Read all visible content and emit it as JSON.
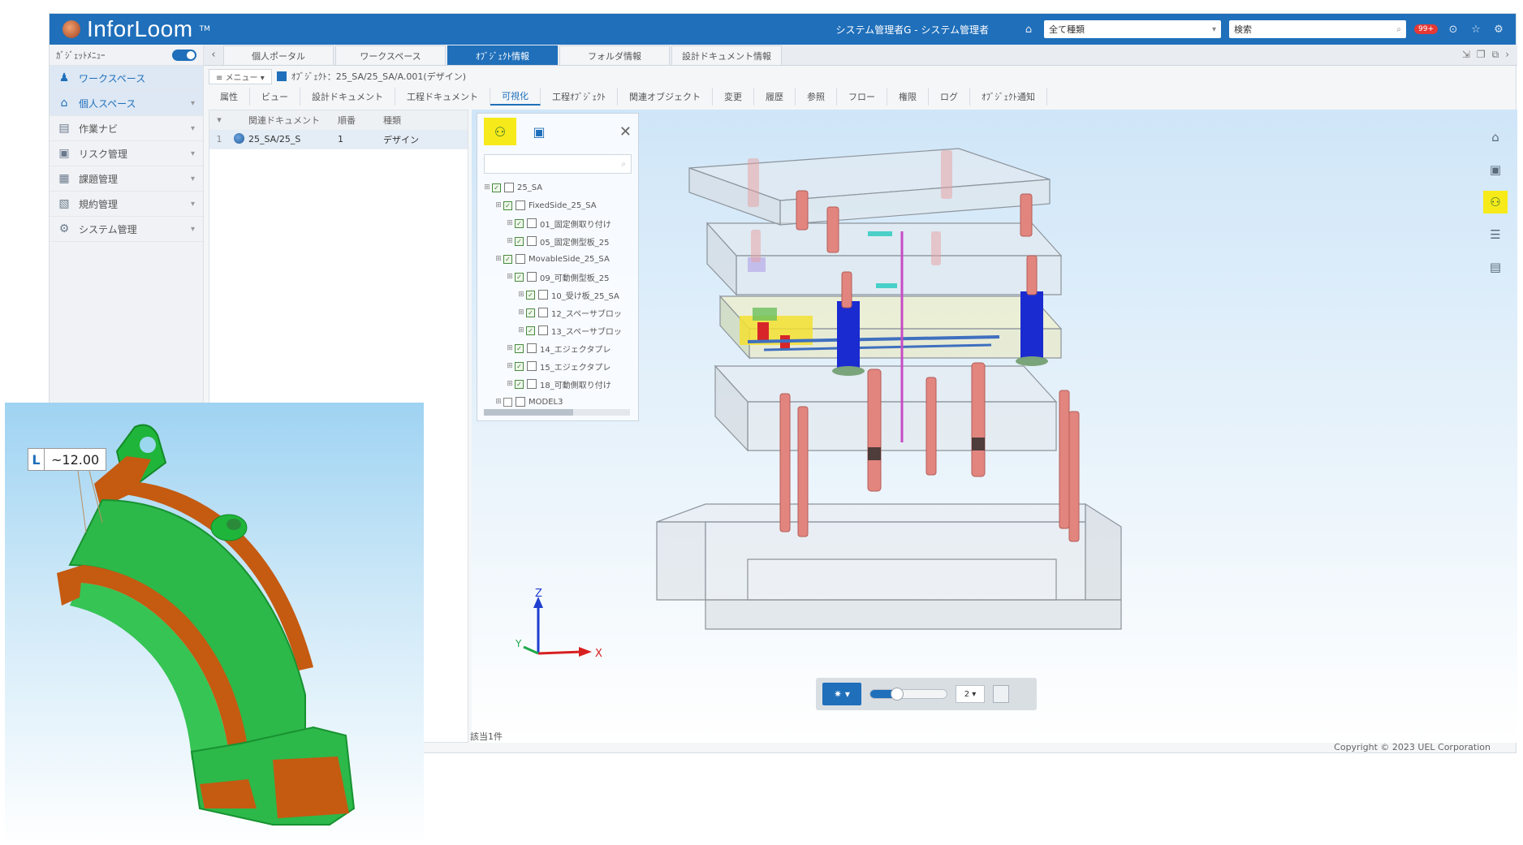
{
  "app": {
    "logo": "InforLoom",
    "logo_tm": "TM",
    "user_label": "システム管理者G - システム管理者",
    "filter_select": "全て種類",
    "search_select": "検索",
    "alert_badge": "99+"
  },
  "sidebar": {
    "gadget_label": "ｶﾞｼﾞｪｯﾄﾒﾆｭｰ",
    "items": [
      {
        "label": "ワークスペース",
        "icon": "workspace-icon"
      },
      {
        "label": "個人スペース",
        "icon": "home-icon"
      },
      {
        "label": "作業ナビ",
        "icon": "navigation-icon"
      },
      {
        "label": "リスク管理",
        "icon": "risk-icon"
      },
      {
        "label": "課題管理",
        "icon": "issue-icon"
      },
      {
        "label": "規約管理",
        "icon": "rule-icon"
      },
      {
        "label": "システム管理",
        "icon": "settings-icon"
      }
    ]
  },
  "tabs": [
    {
      "label": "個人ポータル"
    },
    {
      "label": "ワークスペース"
    },
    {
      "label": "ｵﾌﾞｼﾞｪｸﾄ情報"
    },
    {
      "label": "フォルダ情報"
    },
    {
      "label": "設計ドキュメント情報"
    }
  ],
  "breadcrumb": {
    "menu": "メニュー",
    "path": "ｵﾌﾞｼﾞｪｸﾄ：25_SA/25_SA/A.001(デザイン)"
  },
  "subtabs": [
    "属性",
    "ビュー",
    "設計ドキュメント",
    "工程ドキュメント",
    "可視化",
    "工程ｵﾌﾞｼﾞｪｸﾄ",
    "関連オブジェクト",
    "変更",
    "履歴",
    "参照",
    "フロー",
    "権限",
    "ログ",
    "ｵﾌﾞｼﾞｪｸﾄ通知"
  ],
  "active_subtab": 4,
  "doc_table": {
    "headers": [
      "",
      "",
      "関連ドキュメント",
      "順番",
      "種類"
    ],
    "rows": [
      {
        "no": "1",
        "name": "25_SA/25_S",
        "order": "1",
        "type": "デザイン"
      }
    ]
  },
  "tree": {
    "nodes": [
      {
        "label": "25_SA",
        "level": 0,
        "checked": true
      },
      {
        "label": "FixedSide_25_SA",
        "level": 1,
        "checked": true
      },
      {
        "label": "01_固定側取り付け",
        "level": 2,
        "checked": true
      },
      {
        "label": "05_固定側型板_25",
        "level": 2,
        "checked": true
      },
      {
        "label": "MovableSide_25_SA",
        "level": 1,
        "checked": true
      },
      {
        "label": "09_可動側型板_25",
        "level": 2,
        "checked": true
      },
      {
        "label": "10_受け板_25_SA",
        "level": 3,
        "checked": true
      },
      {
        "label": "12_スペーサブロッ",
        "level": 3,
        "checked": true
      },
      {
        "label": "13_スペーサブロッ",
        "level": 3,
        "checked": true
      },
      {
        "label": "14_エジェクタプレ",
        "level": 2,
        "checked": true
      },
      {
        "label": "15_エジェクタプレ",
        "level": 2,
        "checked": true
      },
      {
        "label": "18_可動側取り付け",
        "level": 2,
        "checked": true
      },
      {
        "label": "MODEL3",
        "level": 1,
        "checked": false
      }
    ]
  },
  "viewer": {
    "axis_z": "Z",
    "axis_x": "X",
    "axis_y": "Y",
    "speed": "2",
    "slider_value": 0.35,
    "count_text": "該当1件"
  },
  "overlay": {
    "dim_prefix": "L",
    "dim_value": "~12.00"
  },
  "footer": {
    "copyright": "Copyright © 2023 UEL Corporation"
  }
}
